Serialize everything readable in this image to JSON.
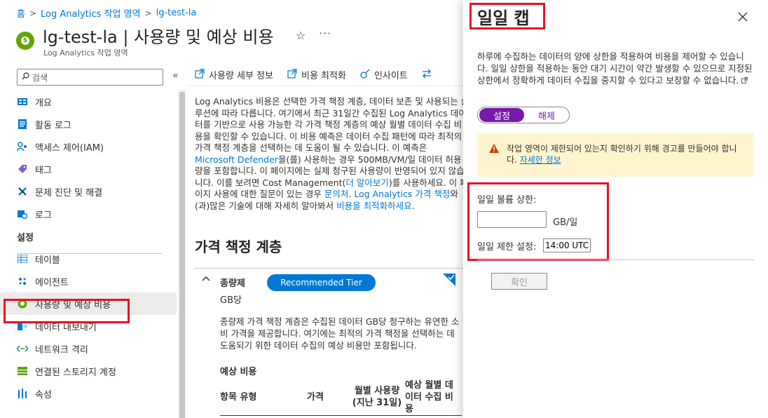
{
  "breadcrumb": {
    "home": "홈",
    "workspaces": "Log Analytics 작업 영역",
    "resource": "lg-test-la",
    "separator": ">"
  },
  "header": {
    "title": "lg-test-la | 사용량 및 예상 비용",
    "subtitle": "Log Analytics 작업 영역",
    "star_icon": "☆",
    "more_icon": "···"
  },
  "sidebar": {
    "search_placeholder": "검색",
    "collapse_icon": "«",
    "items": [
      {
        "label": "개요",
        "icon": "overview-icon"
      },
      {
        "label": "활동 로그",
        "icon": "activity-log-icon"
      },
      {
        "label": "액세스 제어(IAM)",
        "icon": "iam-icon"
      },
      {
        "label": "태그",
        "icon": "tag-icon"
      },
      {
        "label": "문제 진단 및 해결",
        "icon": "wrench-icon"
      },
      {
        "label": "로그",
        "icon": "logs-icon"
      }
    ],
    "section_label": "설정",
    "settings_items": [
      {
        "label": "테이블",
        "icon": "table-icon"
      },
      {
        "label": "에이전트",
        "icon": "agent-icon"
      },
      {
        "label": "사용량 및 예상 비용",
        "icon": "usage-cost-icon",
        "active": true
      },
      {
        "label": "데이터 내보내기",
        "icon": "export-icon"
      },
      {
        "label": "네트워크 격리",
        "icon": "network-icon"
      },
      {
        "label": "연결된 스토리지 계정",
        "icon": "storage-icon"
      },
      {
        "label": "속성",
        "icon": "properties-icon"
      }
    ]
  },
  "toolbar": {
    "usage_details": "사용량 세부 정보",
    "cost_optimization": "비용 최적화",
    "insights": "인사이트"
  },
  "main": {
    "description_parts": [
      "Log Analytics 비용은 선택한 가격 책정 계층, 데이터 보존 및 사용되는 솔루션에 따라 다릅니다. 여기에서 최근 31일간 수집된 Log Analytics 데이터를 기반으로 사용 가능한 각 가격 책정 계층의 예상 월별 데이터 수집 비용을 확인할 수 있습니다. 이 비용 예측은 데이터 수집 패턴에 따라 최적의 가격 책정 계층을 선택하는 데 도움이 될 수 있습니다. 이 예측은 ",
      "Microsoft Defender",
      "을(를) 사용하는 경우 500MB/VM/일 데이터 허용량을 포함합니다. 이 페이지에는 실제 청구된 사용량이 반영되어 있지 않습니다. 이를 보려면 Cost Management(",
      "더 알아보기",
      ")를 사용하세요. 이 페이지 사용에 대한 질문이 있는 경우 ",
      "문의처",
      ". ",
      "Log Analytics 가격 책정",
      "와(과)많은 기술에 대해 자세히 알아봐서 ",
      "비용을 최적화하세요",
      "."
    ],
    "pricing_heading": "가격 책정 계층",
    "tier": {
      "name": "종량제",
      "badge": "Recommended Tier",
      "unit": "GB당",
      "description": "종량제 가격 책정 계층은 수집된 데이터 GB당 청구하는 유연한 소비 가격을 제공합니다. 여기에는 최적의 가격 책정을 선택하는 데 도움되기 위한 데이터 수집의 예상 비용만 포함됩니다.",
      "estimate_label": "예상 비용",
      "columns": [
        "항목 유형",
        "가격",
        "월별 사용량 (지난 31일)",
        "예상 월별 데이터 수집 비용"
      ]
    }
  },
  "panel": {
    "title": "일일 캡",
    "description": "하루에 수집하는 데이터의 양에 상한을 적용하여 비용을 제어할 수 있습니다. 일일 상한을 적용하는 동안 대기 시간이 약간 발생할 수 있으므로 지정된 상한에서 정확하게 데이터 수집을 중지할 수 있다고 보장할 수 없습니다.",
    "toggle_on": "설정",
    "toggle_off": "해제",
    "warning_text": "작업 영역이 제한되어 있는지 확인하기 위해 경고를 만들어야 합니다. ",
    "warning_link": "자세한 정보",
    "volume_label": "일일 볼륨 상한:",
    "volume_value": "",
    "volume_unit": "GB/일",
    "reset_label": "일일 제한 설정:",
    "reset_value": "14:00 UTC",
    "confirm_button": "확인"
  },
  "colors": {
    "accent": "#0078d4",
    "toggle": "#7719aa",
    "highlight": "#e81123",
    "warning_bg": "#fff4ce"
  }
}
